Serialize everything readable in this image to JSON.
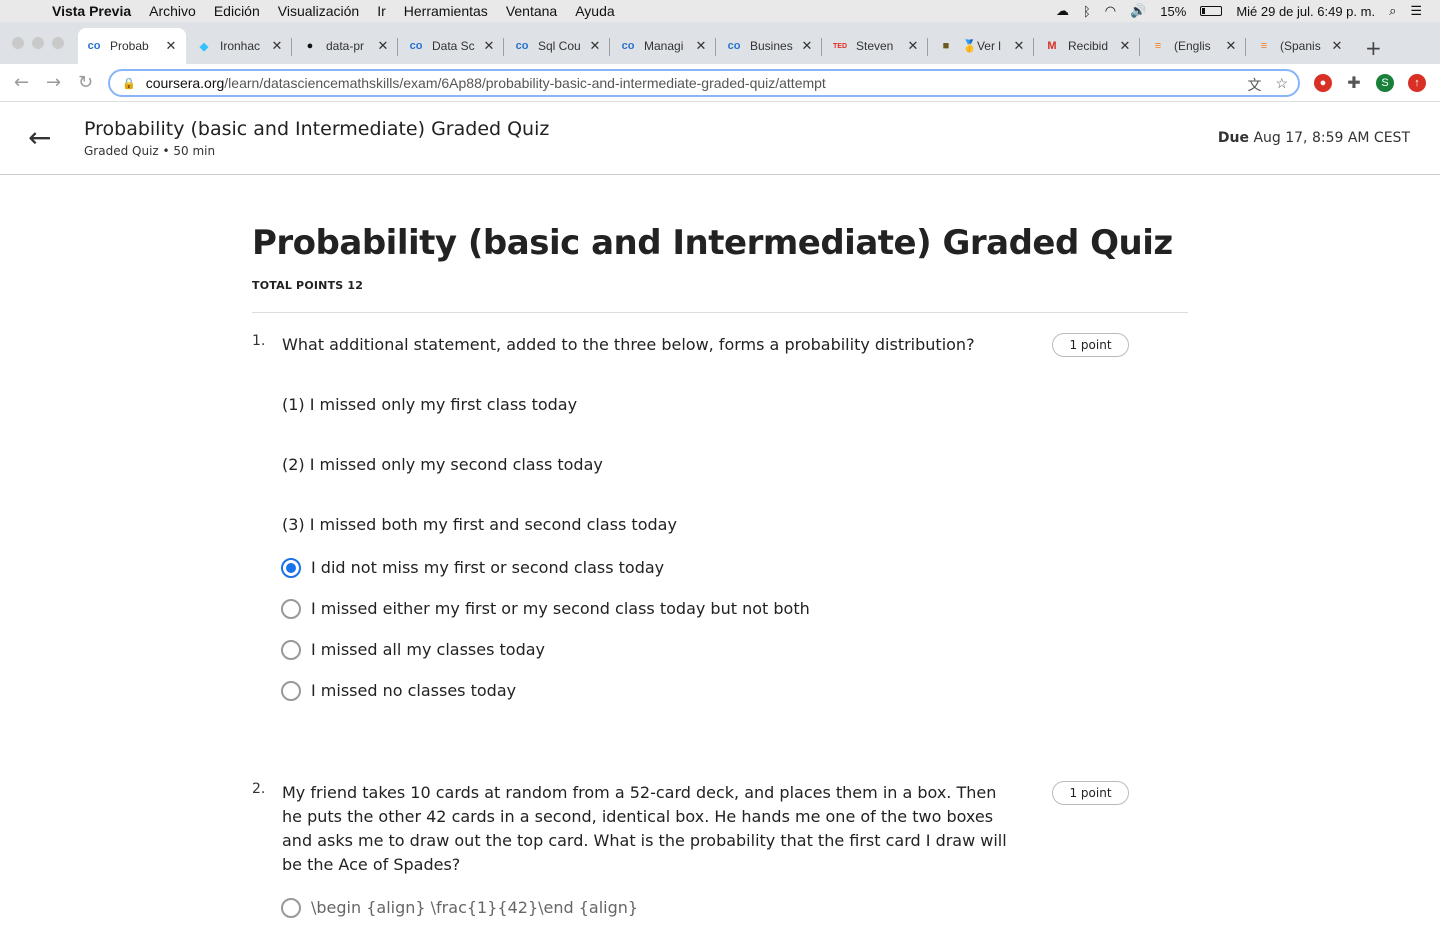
{
  "menubar": {
    "app": "Vista Previa",
    "items": [
      "Archivo",
      "Edición",
      "Visualización",
      "Ir",
      "Herramientas",
      "Ventana",
      "Ayuda"
    ],
    "battery": "15%",
    "clock": "Mié 29 de jul.  6:49 p. m."
  },
  "tabs": [
    {
      "label": "Probab",
      "icon": "coursera-icon",
      "color": "#2a73cc",
      "glyph": "co"
    },
    {
      "label": "Ironhac",
      "icon": "ironhack-icon",
      "color": "#32c3ff",
      "glyph": "◆"
    },
    {
      "label": "data-pr",
      "icon": "github-icon",
      "color": "#111111",
      "glyph": "●"
    },
    {
      "label": "Data Sc",
      "icon": "coursera-icon",
      "color": "#2a73cc",
      "glyph": "co"
    },
    {
      "label": "Sql Cou",
      "icon": "coursera-icon",
      "color": "#2a73cc",
      "glyph": "co"
    },
    {
      "label": "Managi",
      "icon": "coursera-icon",
      "color": "#2a73cc",
      "glyph": "co"
    },
    {
      "label": "Busines",
      "icon": "coursera-icon",
      "color": "#2a73cc",
      "glyph": "co"
    },
    {
      "label": "Steven",
      "icon": "ted-icon",
      "color": "#e62b1e",
      "glyph": "TED"
    },
    {
      "label": "🥇Ver l",
      "icon": "image-icon",
      "color": "#6b5a1e",
      "glyph": "■"
    },
    {
      "label": "Recibid",
      "icon": "gmail-icon",
      "color": "#d93025",
      "glyph": "M"
    },
    {
      "label": "(Englis",
      "icon": "stackoverflow-icon",
      "color": "#f48024",
      "glyph": "≡"
    },
    {
      "label": "(Spanis",
      "icon": "stackoverflow-icon",
      "color": "#f48024",
      "glyph": "≡"
    }
  ],
  "address": {
    "host": "coursera.org",
    "path": "/learn/datasciencemathskills/exam/6Ap88/probability-basic-and-intermediate-graded-quiz/attempt"
  },
  "header": {
    "title": "Probability (basic and Intermediate) Graded Quiz",
    "subtitle": "Graded Quiz • 50 min",
    "due_label": "Due",
    "due_value": "Aug 17, 8:59 AM CEST"
  },
  "quiz": {
    "title": "Probability (basic and Intermediate) Graded Quiz",
    "total_points": "TOTAL POINTS 12",
    "questions": [
      {
        "number": "1.",
        "text": "What additional statement, added to the three below, forms a probability distribution?",
        "points": "1 point",
        "statements": [
          "(1) I missed only my first class today",
          "(2) I missed only my second class today",
          "(3) I missed both my first and second class today"
        ],
        "options": [
          {
            "label": "I did not miss my first or second class today",
            "checked": true
          },
          {
            "label": "I missed either my first or my second class today but not both",
            "checked": false
          },
          {
            "label": "I missed all my classes today",
            "checked": false
          },
          {
            "label": "I missed no classes today",
            "checked": false
          }
        ]
      },
      {
        "number": "2.",
        "text": "My friend takes 10 cards at random from a 52-card deck, and places them in a box. Then he puts the other 42 cards in a second, identical box. He hands me one of the two boxes and asks me to draw out the top card. What is the probability that the first card I draw will be the Ace of Spades?",
        "points": "1 point",
        "options": [
          {
            "label": "\\begin {align} \\frac{1}{42}\\end {align}",
            "checked": false
          }
        ]
      }
    ]
  }
}
